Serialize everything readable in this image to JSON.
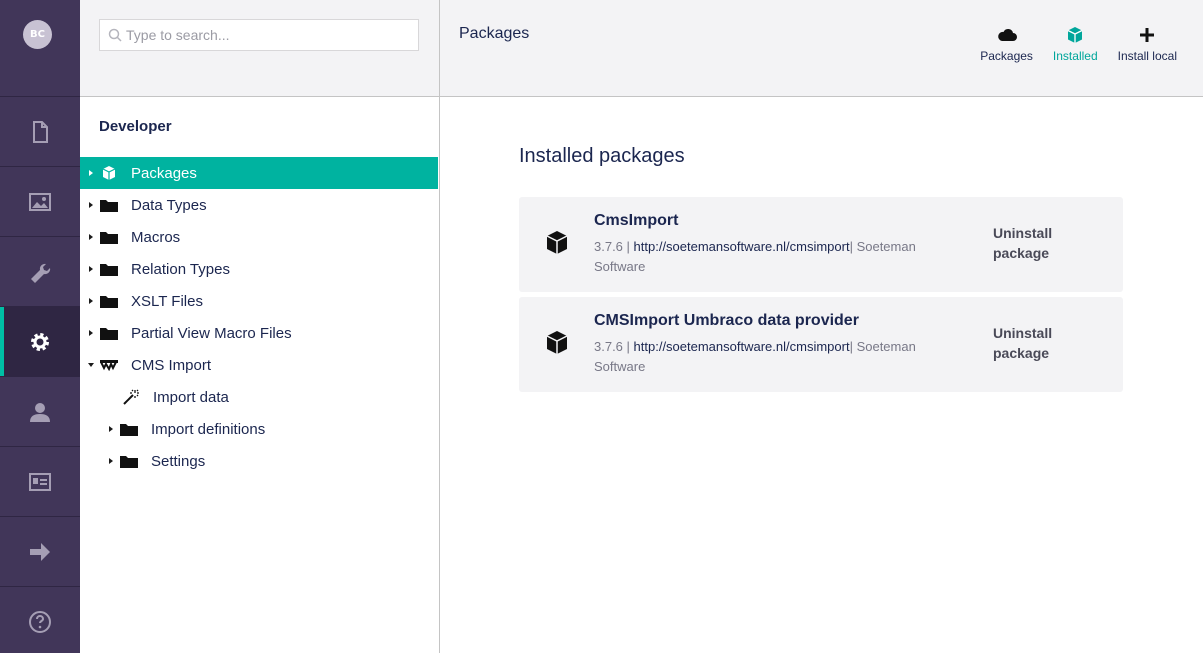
{
  "user": {
    "initials": "BC"
  },
  "rail": {
    "items": [
      {
        "name": "content",
        "icon": "document-icon"
      },
      {
        "name": "media",
        "icon": "image-icon"
      },
      {
        "name": "settings",
        "icon": "wrench-icon"
      },
      {
        "name": "developer",
        "icon": "gear-icon",
        "active": true
      },
      {
        "name": "users",
        "icon": "user-icon"
      },
      {
        "name": "members",
        "icon": "id-card-icon"
      },
      {
        "name": "forms",
        "icon": "arrow-right-icon"
      }
    ],
    "help_icon": "help-icon"
  },
  "tree": {
    "search_placeholder": "Type to search...",
    "section_title": "Developer",
    "nodes": [
      {
        "label": "Packages",
        "icon": "package-icon",
        "selected": true
      },
      {
        "label": "Data Types",
        "icon": "folder-icon"
      },
      {
        "label": "Macros",
        "icon": "folder-icon"
      },
      {
        "label": "Relation Types",
        "icon": "folder-icon"
      },
      {
        "label": "XSLT Files",
        "icon": "folder-icon"
      },
      {
        "label": "Partial View Macro Files",
        "icon": "folder-icon"
      },
      {
        "label": "CMS Import",
        "icon": "cmsimport-logo-icon",
        "expanded": true
      },
      {
        "label": "Import data",
        "icon": "magic-wand-icon",
        "child": true
      },
      {
        "label": "Import definitions",
        "icon": "folder-icon",
        "child": true
      },
      {
        "label": "Settings",
        "icon": "folder-icon",
        "child": true
      }
    ]
  },
  "header": {
    "title": "Packages",
    "tabs": [
      {
        "label": "Packages",
        "icon": "cloud-icon"
      },
      {
        "label": "Installed",
        "icon": "package-icon",
        "active": true
      },
      {
        "label": "Install local",
        "icon": "plus-icon"
      }
    ]
  },
  "main": {
    "section_title": "Installed packages",
    "packages": [
      {
        "name": "CmsImport",
        "version": "3.7.6",
        "url": "http://soetemansoftware.nl/cmsimport",
        "author": "Soeteman Software",
        "action": "Uninstall package"
      },
      {
        "name": "CMSImport Umbraco data provider",
        "version": "3.7.6",
        "url": "http://soetemansoftware.nl/cmsimport",
        "author": "Soeteman Software",
        "action": "Uninstall package"
      }
    ]
  },
  "colors": {
    "rail": "#413659",
    "accent": "#00b3a0",
    "header_bg": "#f3f3f5"
  }
}
